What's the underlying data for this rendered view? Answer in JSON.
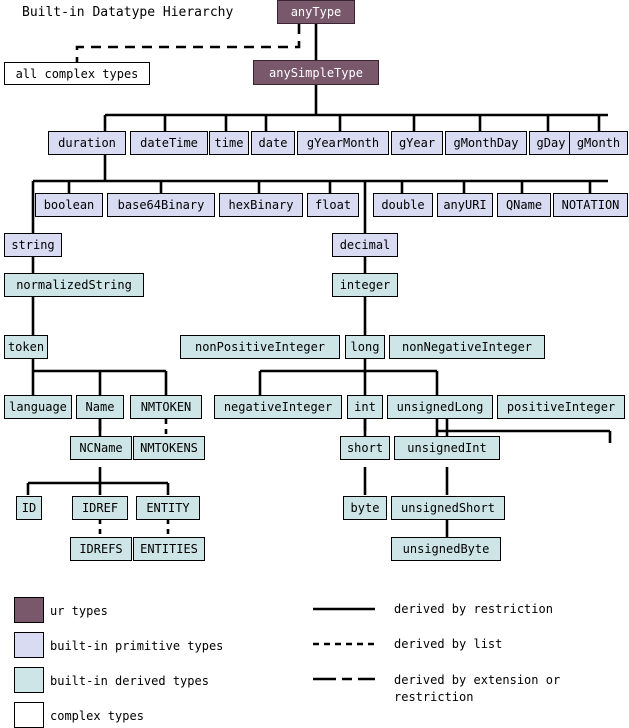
{
  "title": "Built-in Datatype Hierarchy",
  "palette": {
    "ur_types": "#7a586c",
    "builtin_primitive": "#d8dbf2",
    "builtin_derived": "#cde5e6",
    "complex_types": "#ffffff",
    "line": "#000000",
    "background": "#ffffff"
  },
  "nodes": {
    "anyType": "anyType",
    "allComplexTypes": "all complex types",
    "anySimpleType": "anySimpleType",
    "duration": "duration",
    "dateTime": "dateTime",
    "time": "time",
    "date": "date",
    "gYearMonth": "gYearMonth",
    "gYear": "gYear",
    "gMonthDay": "gMonthDay",
    "gDay": "gDay",
    "gMonth": "gMonth",
    "boolean": "boolean",
    "base64Binary": "base64Binary",
    "hexBinary": "hexBinary",
    "float": "float",
    "double": "double",
    "anyURI": "anyURI",
    "QName": "QName",
    "NOTATION": "NOTATION",
    "string": "string",
    "decimal": "decimal",
    "normalizedString": "normalizedString",
    "integer": "integer",
    "token": "token",
    "nonPositiveInteger": "nonPositiveInteger",
    "long": "long",
    "nonNegativeInteger": "nonNegativeInteger",
    "language": "language",
    "Name": "Name",
    "NMTOKEN": "NMTOKEN",
    "negativeInteger": "negativeInteger",
    "int": "int",
    "unsignedLong": "unsignedLong",
    "positiveInteger": "positiveInteger",
    "NCName": "NCName",
    "NMTOKENS": "NMTOKENS",
    "short": "short",
    "unsignedInt": "unsignedInt",
    "ID": "ID",
    "IDREF": "IDREF",
    "ENTITY": "ENTITY",
    "byte": "byte",
    "unsignedShort": "unsignedShort",
    "IDREFS": "IDREFS",
    "ENTITIES": "ENTITIES",
    "unsignedByte": "unsignedByte"
  },
  "legend": {
    "swatches": [
      {
        "label": "ur types",
        "color": "#7a586c"
      },
      {
        "label": "built-in primitive types",
        "color": "#d8dbf2"
      },
      {
        "label": "built-in derived types",
        "color": "#cde5e6"
      },
      {
        "label": "complex types",
        "color": "#ffffff"
      }
    ],
    "lines": [
      {
        "label": "derived by restriction",
        "style": "solid"
      },
      {
        "label": "derived by list",
        "style": "dashed"
      },
      {
        "label": "derived by extension or restriction",
        "style": "dash-dot"
      }
    ]
  }
}
